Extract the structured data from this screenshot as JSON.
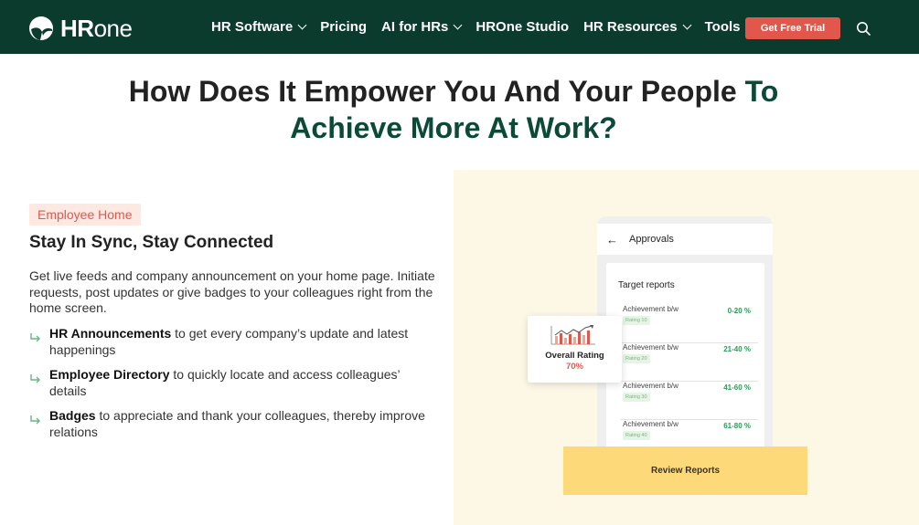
{
  "brand": {
    "logo_text_bold": "HR",
    "logo_text_light": "one"
  },
  "nav": {
    "items": [
      {
        "label": "HR Software",
        "has_dropdown": true
      },
      {
        "label": "Pricing",
        "has_dropdown": false
      },
      {
        "label": "AI for HRs",
        "has_dropdown": true
      },
      {
        "label": "HROne Studio",
        "has_dropdown": false
      },
      {
        "label": "HR Resources",
        "has_dropdown": true
      },
      {
        "label": "Tools",
        "has_dropdown": true
      }
    ],
    "cta_label": "Get Free Trial",
    "search_icon": "search-icon"
  },
  "headline": {
    "part1": "How Does It Empower You And Your People",
    "part2": "To",
    "part3": "Achieve More At Work?"
  },
  "content": {
    "badge": "Employee Home",
    "subhead": "Stay In Sync, Stay Connected",
    "description": "Get live feeds and company announcement on your home page. Initiate requests, post updates or give badges to your colleagues right from the home screen.",
    "features": [
      {
        "bold": "HR Announcements",
        "text": " to get every company’s update and latest happenings"
      },
      {
        "bold": "Employee Directory",
        "text": " to quickly locate and access colleagues’ details"
      },
      {
        "bold": "Badges",
        "text": " to appreciate and thank your colleagues, thereby improve relations"
      }
    ]
  },
  "mockup": {
    "screen_title": "Approvals",
    "card_title": "Target reports",
    "reports": [
      {
        "label": "Achievement b/w",
        "chip": "Rating 10",
        "range": "0-20 %"
      },
      {
        "label": "Achievement b/w",
        "chip": "Rating 20",
        "range": "21-40 %"
      },
      {
        "label": "Achievement b/w",
        "chip": "Rating 30",
        "range": "41-60 %"
      },
      {
        "label": "Achievement b/w",
        "chip": "Rating 40",
        "range": "61-80 %"
      }
    ],
    "rating_label": "Overall Rating",
    "rating_value": "70%",
    "review_button": "Review Reports"
  },
  "colors": {
    "nav_bg": "#0b3b2c",
    "accent_green": "#0b4a36",
    "cta_red": "#e2574c",
    "panel_bg": "#fdf7e6",
    "review_yellow": "#fdd97a",
    "pct_green": "#2e9a57"
  }
}
